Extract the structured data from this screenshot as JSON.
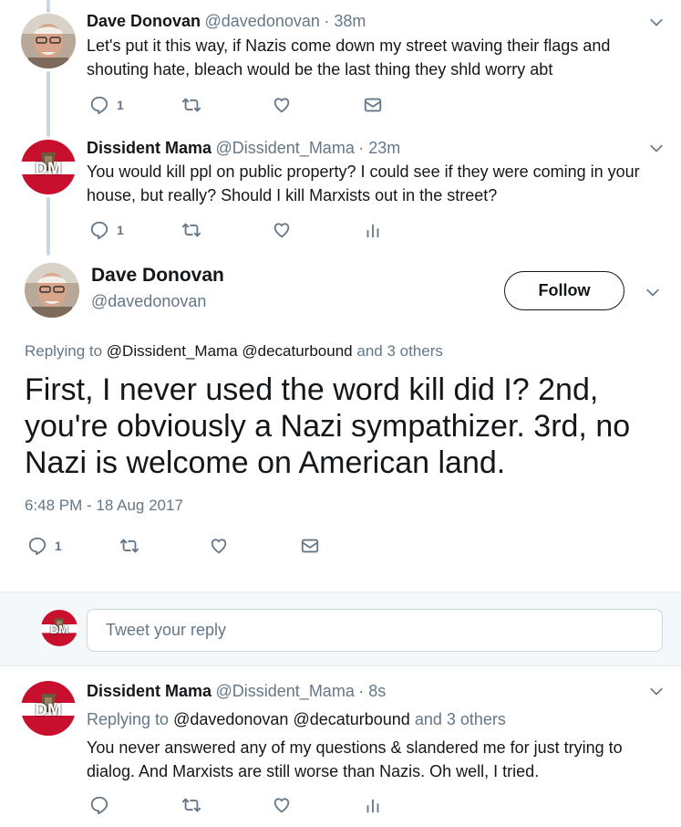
{
  "tweets": [
    {
      "name": "Dave Donovan",
      "handle": "@davedonovan",
      "time": "· 38m",
      "line1": "Let's put it this way, if Nazis come down my street waving their flags and",
      "line2": "shouting hate, bleach would be the last thing they shld worry abt",
      "reply_count": "1"
    },
    {
      "name": "Dissident Mama",
      "handle": "@Dissident_Mama",
      "time": "· 23m",
      "line1": "You would kill ppl on public property? I could see if they were coming in your",
      "line2": "house, but really? Should I kill Marxists out in the street?",
      "reply_count": "1"
    }
  ],
  "focus": {
    "name": "Dave Donovan",
    "handle": "@davedonovan",
    "follow_label": "Follow",
    "replying_prefix": "Replying to",
    "replying_users": "@Dissident_Mama @decaturbound",
    "replying_suffix": "and 3 others",
    "line1": "First, I never used the word kill did I? 2nd,",
    "line2": "you're obviously a Nazi sympathizer. 3rd, no",
    "line3": "Nazi is welcome on American land.",
    "timestamp": "6:48 PM - 18 Aug 2017",
    "reply_count": "1"
  },
  "composer": {
    "placeholder": "Tweet your reply"
  },
  "reply": {
    "name": "Dissident Mama",
    "handle": "@Dissident_Mama",
    "time": "· 8s",
    "replying_prefix": "Replying to",
    "replying_users": "@davedonovan @decaturbound",
    "replying_suffix": "and 3 others",
    "line1": "You never answered any of my questions & slandered me for just trying to",
    "line2": "dialog. And Marxists are still worse than Nazis. Oh well, I tried."
  },
  "avatar_text": "DM",
  "colors": {
    "link": "#1b95e0",
    "muted": "#657786",
    "avatar_red": "#c8102e",
    "composer_bg": "#f5f8fa"
  },
  "icons": [
    "reply-icon",
    "retweet-icon",
    "like-icon",
    "dm-icon",
    "analytics-icon",
    "chevron-down-icon"
  ]
}
